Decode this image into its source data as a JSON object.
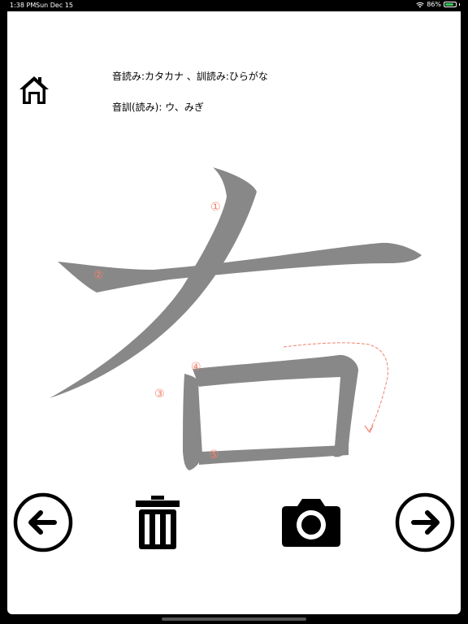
{
  "status_bar": {
    "time": "1:38 PM",
    "date": "Sun Dec 15",
    "battery_percent": "86%",
    "battery_level": 0.86
  },
  "header": {
    "reading_note": "音読み:カタカナ 、訓読み:ひらがな",
    "readings": "音訓(読み): ウ、みぎ"
  },
  "kanji": {
    "character": "右",
    "stroke_numbers": [
      "①",
      "②",
      "③",
      "④",
      "⑤"
    ],
    "stroke_color": "#888888",
    "guide_color": "#f0826e"
  },
  "icons": {
    "home": "home-icon",
    "prev": "arrow-left-circle-icon",
    "delete": "trash-icon",
    "camera": "camera-icon",
    "next": "arrow-right-circle-icon"
  }
}
